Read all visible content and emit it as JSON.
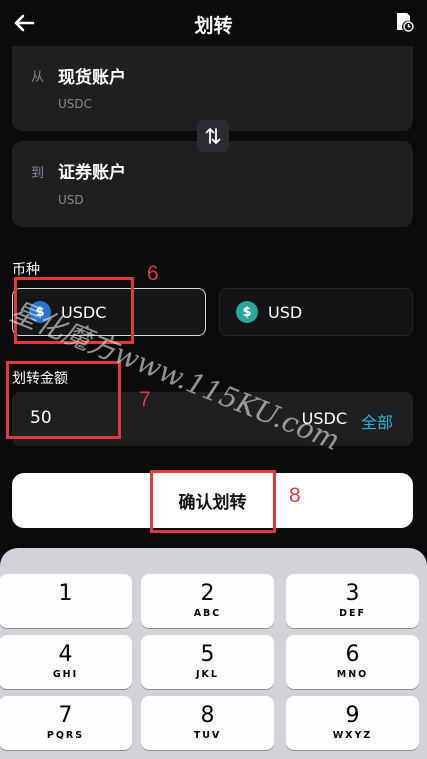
{
  "header": {
    "title": "划转",
    "back_icon": "back-arrow-icon",
    "history_icon": "history-icon"
  },
  "from": {
    "prep": "从",
    "account": "现货账户",
    "currency": "USDC"
  },
  "to": {
    "prep": "到",
    "account": "证券账户",
    "currency": "USD"
  },
  "swap_icon": "swap-arrows-icon",
  "coin": {
    "label": "币种",
    "options": [
      {
        "name": "USDC",
        "icon": "usdc-coin-icon",
        "selected": true
      },
      {
        "name": "USD",
        "icon": "usd-coin-icon",
        "selected": false
      }
    ]
  },
  "amount": {
    "label": "划转金额",
    "value": "50",
    "unit": "USDC",
    "all_label": "全部"
  },
  "confirm_label": "确认划转",
  "annotations": [
    "6",
    "7",
    "8"
  ],
  "watermark": "星化魔方www.115KU.com",
  "keyboard": {
    "keys": [
      {
        "digit": "1",
        "letters": ""
      },
      {
        "digit": "2",
        "letters": "ABC"
      },
      {
        "digit": "3",
        "letters": "DEF"
      },
      {
        "digit": "4",
        "letters": "GHI"
      },
      {
        "digit": "5",
        "letters": "JKL"
      },
      {
        "digit": "6",
        "letters": "MNO"
      },
      {
        "digit": "7",
        "letters": "PQRS"
      },
      {
        "digit": "8",
        "letters": "TUV"
      },
      {
        "digit": "9",
        "letters": "WXYZ"
      }
    ]
  },
  "colors": {
    "accent": "#2fb4d6",
    "annotation_red": "#e23a3a",
    "usdc": "#2775ca",
    "usd": "#2aa59a"
  }
}
